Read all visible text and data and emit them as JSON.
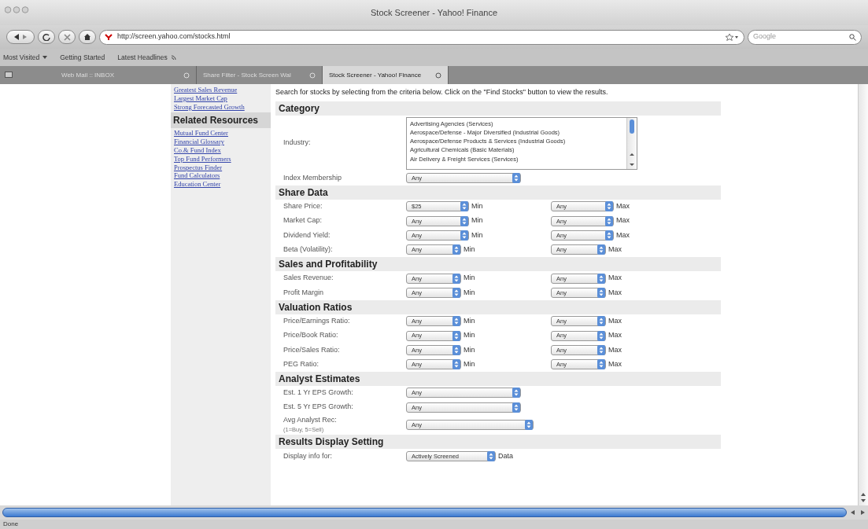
{
  "window": {
    "title": "Stock Screener - Yahoo! Finance"
  },
  "toolbar": {
    "url": "http://screen.yahoo.com/stocks.html",
    "search": {
      "placeholder": "Google"
    }
  },
  "bookmarks": [
    {
      "label": "Most Visited",
      "kind": "menu"
    },
    {
      "label": "Getting Started",
      "kind": "plain"
    },
    {
      "label": "Latest Headlines",
      "kind": "feed"
    }
  ],
  "tabs": [
    {
      "label": "Web Mail :: INBOX",
      "selected": false
    },
    {
      "label": "Share Filter - Stock Screen Wal",
      "selected": false
    },
    {
      "label": "Stock Screener - Yahoo! Finance",
      "selected": true
    }
  ],
  "sidebar": {
    "top_links": [
      "Greatest Sales Revenue",
      "Largest Market Cap",
      "Strong Forecasted Growth"
    ],
    "heading": "Related Resources",
    "links": [
      "Mutual Fund Center",
      "Financial Glossary",
      "Co.& Fund Index",
      "Top Fund Performers",
      "Prospectus Finder",
      "Fund Calculators",
      "Education Center"
    ]
  },
  "intro": "Search for stocks by selecting from the criteria below. Click on the \"Find Stocks\" button to view the results.",
  "sections": [
    {
      "title": "Category",
      "fields": [
        {
          "kind": "listbox",
          "label": "Industry:",
          "options": [
            "Advertising Agencies (Services)",
            "Aerospace/Defense - Major Diversified (Industrial Goods)",
            "Aerospace/Defense Products & Services (Industrial Goods)",
            "Agricultural Chemicals (Basic Materials)",
            "Air Delivery & Freight Services (Services)"
          ]
        },
        {
          "kind": "single",
          "label": "Index Membership",
          "value": "Any"
        }
      ]
    },
    {
      "title": "Share Data",
      "fields": [
        {
          "kind": "range",
          "label": "Share Price:",
          "min": "$25",
          "min_label": "Min",
          "max": "Any",
          "max_label": "Max"
        },
        {
          "kind": "range",
          "label": "Market Cap:",
          "min": "Any",
          "min_label": "Min",
          "max": "Any",
          "max_label": "Max"
        },
        {
          "kind": "range",
          "label": "Dividend Yield:",
          "min": "Any",
          "min_label": "Min",
          "max": "Any",
          "max_label": "Max"
        },
        {
          "kind": "range",
          "label": "Beta (Volatility):",
          "min": "Any",
          "min_label": "Min",
          "max": "Any",
          "max_label": "Max"
        }
      ]
    },
    {
      "title": "Sales and Profitability",
      "fields": [
        {
          "kind": "range",
          "label": "Sales Revenue:",
          "min": "Any",
          "min_label": "Min",
          "max": "Any",
          "max_label": "Max"
        },
        {
          "kind": "range",
          "label": "Profit Margin",
          "min": "Any",
          "min_label": "Min",
          "max": "Any",
          "max_label": "Max"
        }
      ]
    },
    {
      "title": "Valuation Ratios",
      "fields": [
        {
          "kind": "range",
          "label": "Price/Earnings Ratio:",
          "min": "Any",
          "min_label": "Min",
          "max": "Any",
          "max_label": "Max"
        },
        {
          "kind": "range",
          "label": "Price/Book Ratio:",
          "min": "Any",
          "min_label": "Min",
          "max": "Any",
          "max_label": "Max"
        },
        {
          "kind": "range",
          "label": "Price/Sales Ratio:",
          "min": "Any",
          "min_label": "Min",
          "max": "Any",
          "max_label": "Max"
        },
        {
          "kind": "range",
          "label": "PEG Ratio:",
          "min": "Any",
          "min_label": "Min",
          "max": "Any",
          "max_label": "Max"
        }
      ]
    },
    {
      "title": "Analyst Estimates",
      "fields": [
        {
          "kind": "single",
          "label": "Est. 1 Yr EPS Growth:",
          "value": "Any"
        },
        {
          "kind": "single",
          "label": "Est. 5 Yr EPS Growth:",
          "value": "Any"
        },
        {
          "kind": "single",
          "label": "Avg Analyst Rec:",
          "note": "(1=Buy, 5=Sell)",
          "value": "Any"
        }
      ]
    },
    {
      "title": "Results Display Setting",
      "fields": [
        {
          "kind": "suffix",
          "label": "Display info for:",
          "value": "Actively Screened",
          "suffix": "Data"
        }
      ]
    }
  ],
  "status_bar": "Done"
}
